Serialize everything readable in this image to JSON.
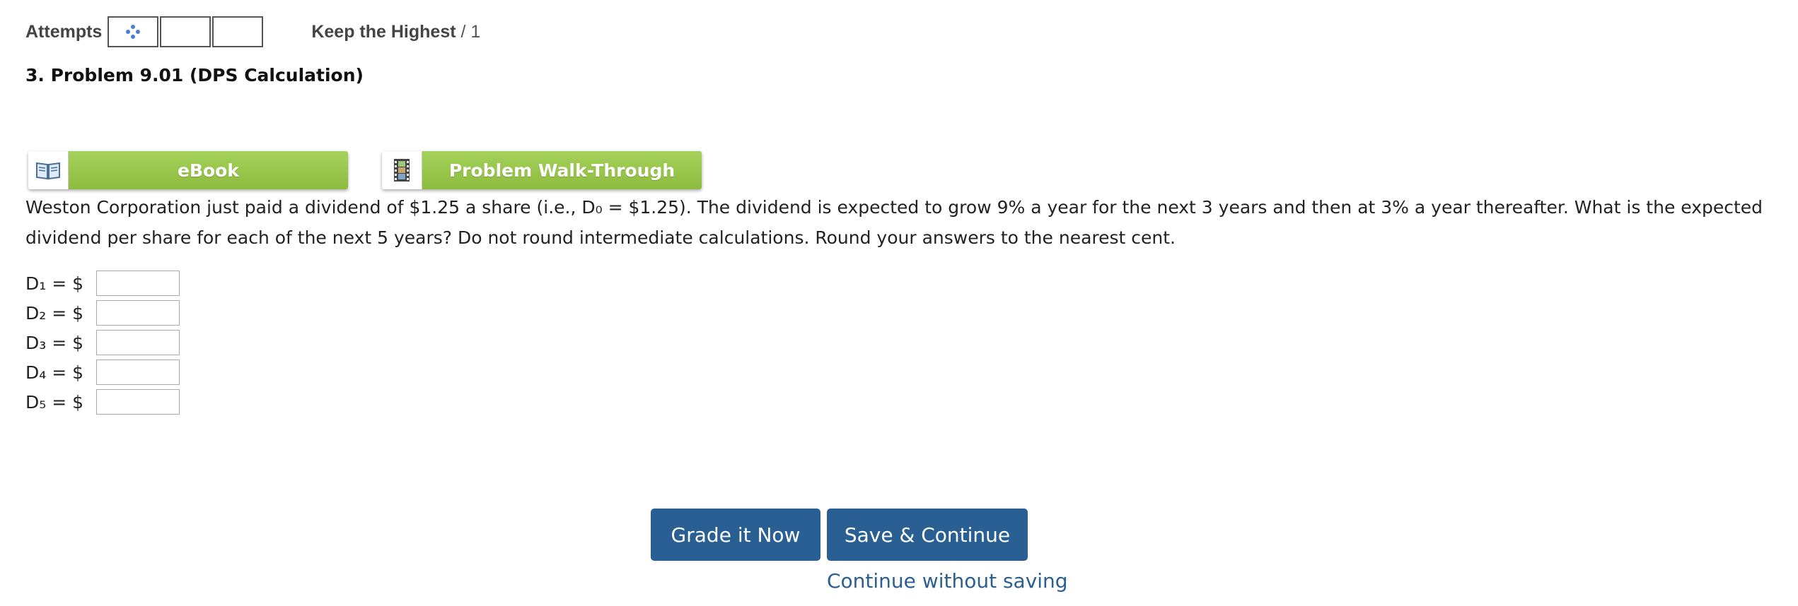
{
  "attempts": {
    "label": "Attempts",
    "boxes": [
      "loading",
      "",
      ""
    ],
    "keep_label": "Keep the Highest",
    "separator": "/",
    "max": "1"
  },
  "problem": {
    "title": "3.  Problem 9.01 (DPS Calculation)"
  },
  "resources": {
    "ebook_label": "eBook",
    "walkthrough_label": "Problem Walk-Through"
  },
  "question": {
    "text": "Weston Corporation just paid a dividend of $1.25 a share (i.e., D₀ = $1.25). The dividend is expected to grow 9% a year for the next 3 years and then at 3% a year thereafter. What is the expected dividend per share for each of the next 5 years? Do not round intermediate calculations. Round your answers to the nearest cent."
  },
  "answers": [
    {
      "label": "D₁ = $",
      "value": ""
    },
    {
      "label": "D₂ = $",
      "value": ""
    },
    {
      "label": "D₃ = $",
      "value": ""
    },
    {
      "label": "D₄ = $",
      "value": ""
    },
    {
      "label": "D₅ = $",
      "value": ""
    }
  ],
  "actions": {
    "grade_label": "Grade it Now",
    "save_label": "Save & Continue",
    "continue_label": "Continue without saving"
  },
  "colors": {
    "accent_blue": "#2a5f94",
    "resource_green": "#99c64b",
    "loading_dots": "#4a7fd6"
  },
  "icons": {
    "ebook": "book-icon",
    "walkthrough": "film-strip-icon",
    "attempt_loading": "loading-dots-icon"
  }
}
